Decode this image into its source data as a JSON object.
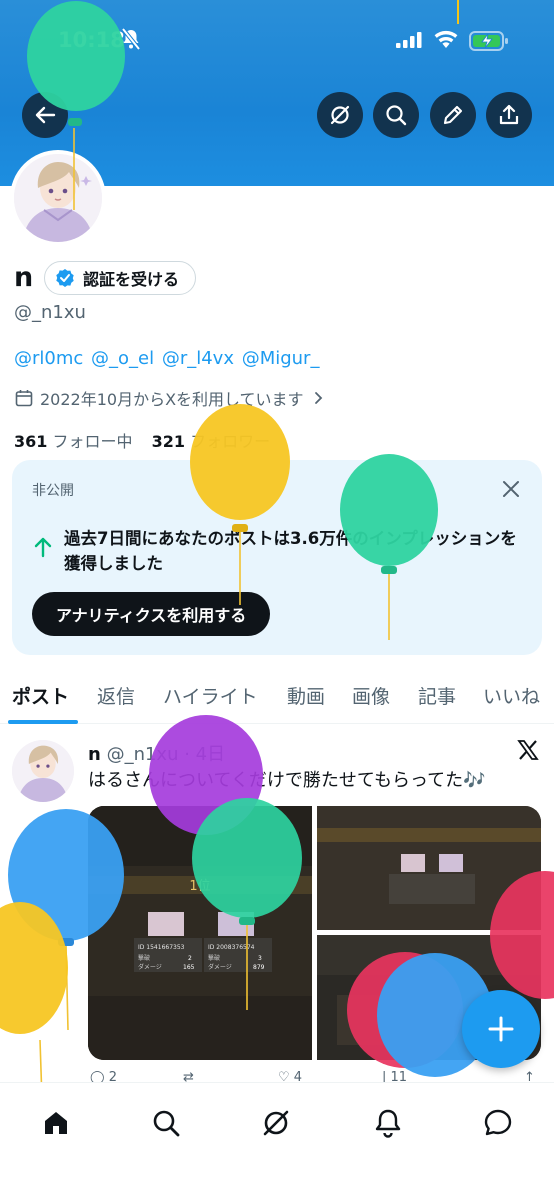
{
  "status_bar": {
    "time": "10:18"
  },
  "profile": {
    "display_name": "n",
    "verify_button_label": "認証を受ける",
    "handle": "@_n1xu",
    "bio_mentions": "@rl0mc @_o_el @r_l4vx @Migur_",
    "joined": "2022年10月からXを利用しています",
    "following_count": "361",
    "following_label": "フォロー中",
    "followers_count": "321",
    "followers_label": "フォロワー"
  },
  "analytics_card": {
    "private_label": "非公開",
    "message": "過去7日間にあなたのポストは3.6万件のインプレッションを獲得しました",
    "cta_label": "アナリティクスを利用する"
  },
  "tabs": [
    {
      "label": "ポスト",
      "active": true
    },
    {
      "label": "返信"
    },
    {
      "label": "ハイライト"
    },
    {
      "label": "動画"
    },
    {
      "label": "画像"
    },
    {
      "label": "記事"
    },
    {
      "label": "いいね"
    }
  ],
  "post": {
    "name": "n",
    "handle": "@_n1xu",
    "time": "4日",
    "text": "はるさんについてくだけで勝たせてもらってた🎶",
    "media": {
      "rank_label": "1位",
      "id_a": "ID 1541667353",
      "id_b": "ID 2008376574",
      "row_hits": "撃破",
      "row_damage": "ダメージ",
      "hits_a": "2",
      "hits_b": "3",
      "dmg_a": "165",
      "dmg_b": "879"
    },
    "reply_count": "2",
    "like_count": "4",
    "view_count": "11"
  },
  "colors": {
    "accent": "#1d9bf0",
    "banner": "#1a84d6",
    "card_bg": "#e8f5fd",
    "text": "#0f1419",
    "muted": "#536471"
  },
  "icons": {
    "header": [
      "back-arrow-icon",
      "grok-icon",
      "search-icon",
      "edit-pencil-icon",
      "share-icon"
    ],
    "bottom_nav": [
      "home-icon",
      "search-icon",
      "grok-icon",
      "notifications-bell-icon",
      "messages-icon"
    ]
  }
}
